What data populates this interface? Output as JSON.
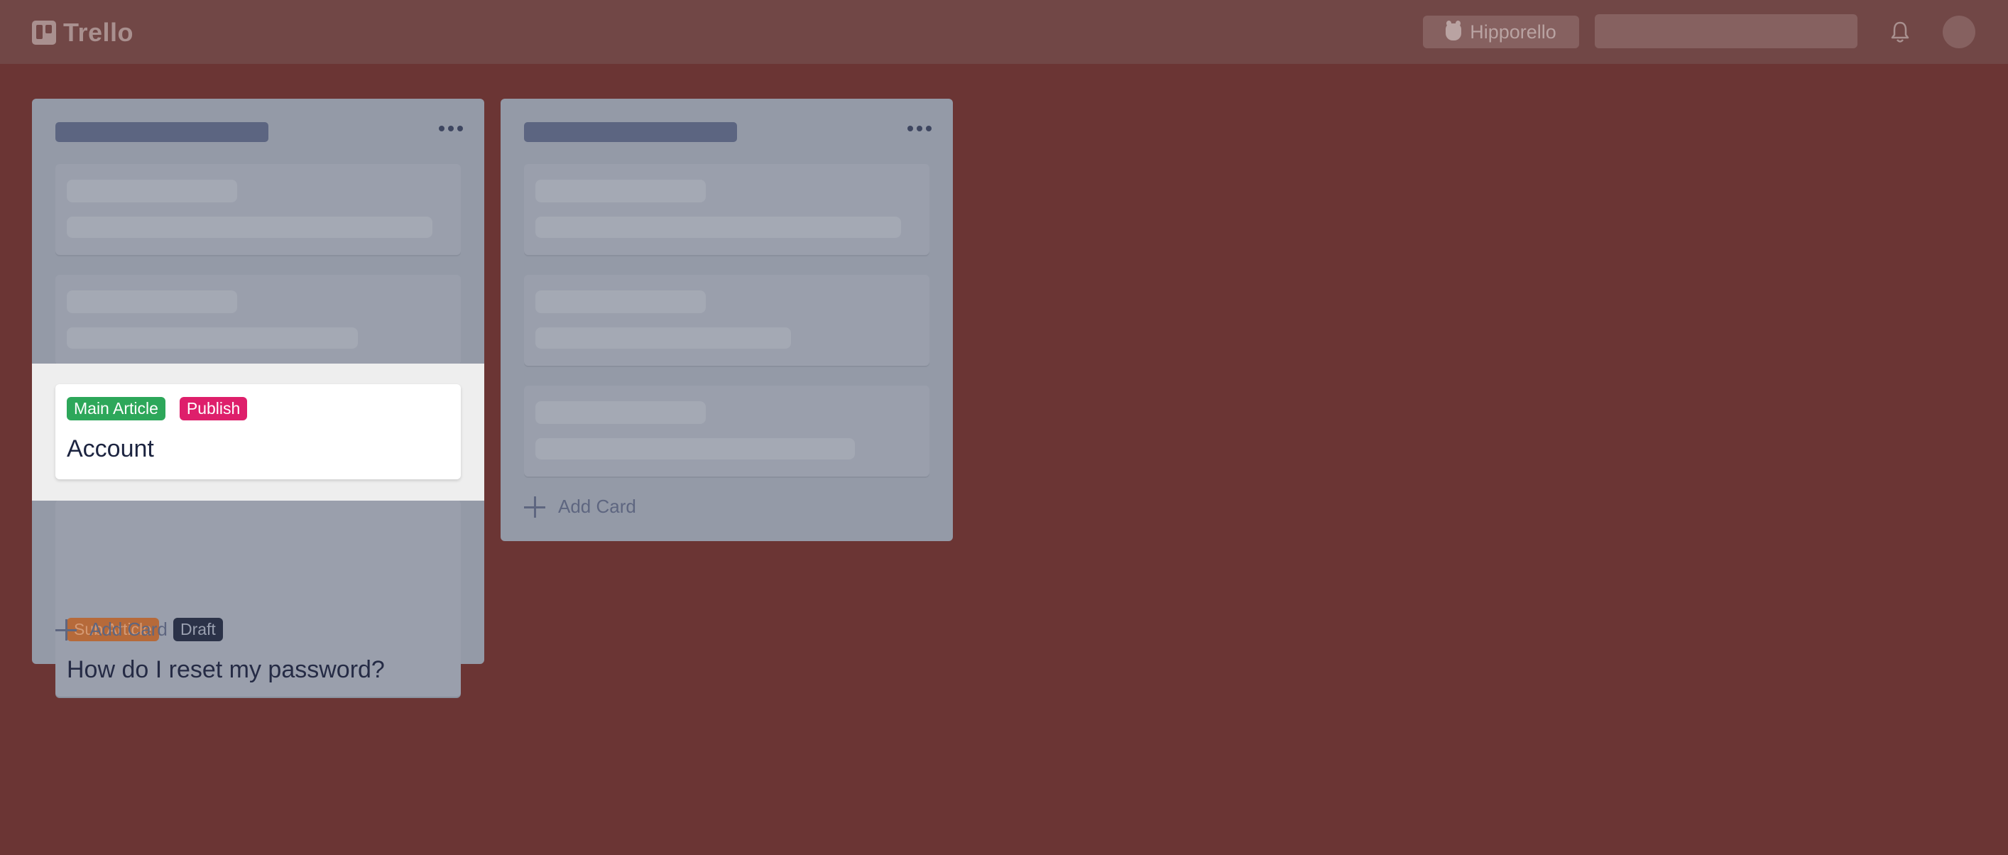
{
  "header": {
    "app_name": "Trello",
    "workspace_label": "Hipporello",
    "logo_icon": "trello-logo-icon",
    "bell_icon": "bell-icon"
  },
  "lists": [
    {
      "add_card_label": "Add Card",
      "highlighted_card": {
        "labels": [
          {
            "text": "Main Article",
            "color": "#2da75a"
          },
          {
            "text": "Publish",
            "color": "#de1f6b"
          }
        ],
        "title": "Account"
      },
      "dimmed_card": {
        "labels": [
          {
            "text": "Sub Article",
            "color": "#b66a3a"
          },
          {
            "text": "Draft",
            "color": "#2b3248"
          }
        ],
        "title": "How do I reset my password?"
      }
    },
    {
      "add_card_label": "Add Card"
    }
  ],
  "colors": {
    "board_background": "#6b3534",
    "main_article": "#2da75a",
    "publish": "#de1f6b"
  }
}
